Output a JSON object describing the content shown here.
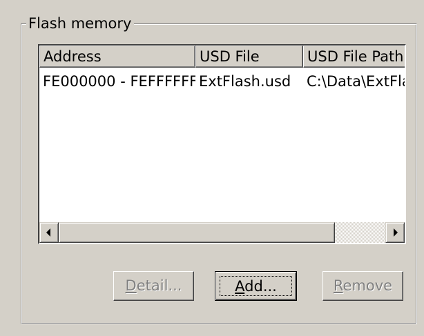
{
  "group": {
    "title": "Flash memory"
  },
  "list": {
    "columns": [
      "Address",
      "USD File",
      "USD File Path"
    ],
    "rows": [
      [
        "FE000000 - FEFFFFFF",
        "ExtFlash.usd",
        "C:\\Data\\ExtFla"
      ]
    ]
  },
  "buttons": {
    "detail": {
      "mnemonic": "D",
      "rest": "etail...",
      "enabled": false
    },
    "add": {
      "mnemonic": "A",
      "rest": "dd...",
      "enabled": true
    },
    "remove": {
      "mnemonic": "R",
      "rest": "emove",
      "enabled": false
    }
  },
  "colors": {
    "face": "#d4d0c8",
    "disabled_text": "#808080",
    "list_bg": "#ffffff"
  },
  "icons": {
    "scroll_left": "arrow-left-icon",
    "scroll_right": "arrow-right-icon"
  }
}
